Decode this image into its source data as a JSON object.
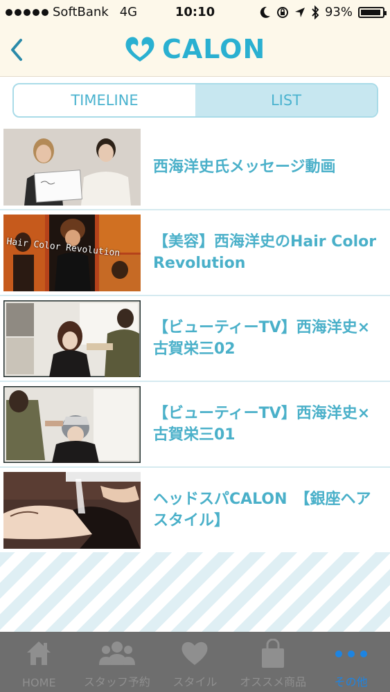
{
  "status_bar": {
    "carrier": "SoftBank",
    "network": "4G",
    "time": "10:10",
    "battery": "93%",
    "battery_level": 0.93
  },
  "header": {
    "logo_text": "CALON",
    "back_icon": "chevron-left-icon"
  },
  "segment": {
    "tabs": [
      {
        "label": "TIMELINE",
        "active": false
      },
      {
        "label": "LIST",
        "active": true
      }
    ]
  },
  "videos": [
    {
      "title": "西海洋史氏メッセージ動画"
    },
    {
      "title": "【美容】西海洋史のHair Color Revolution",
      "thumb_caption": "Hair Color Revolution"
    },
    {
      "title": "【ビューティーTV】西海洋史×古賀栄三02"
    },
    {
      "title": "【ビューティーTV】西海洋史×古賀栄三01"
    },
    {
      "title": "ヘッドスパCALON　【銀座ヘアスタイル】"
    }
  ],
  "tabbar": {
    "items": [
      {
        "label": "HOME",
        "icon": "home-icon"
      },
      {
        "label": "スタッフ予約",
        "icon": "staff-icon"
      },
      {
        "label": "スタイル",
        "icon": "heart-icon"
      },
      {
        "label": "オススメ商品",
        "icon": "shopping-bag-icon"
      },
      {
        "label": "その他",
        "icon": "more-dots-icon",
        "active": true
      }
    ]
  },
  "colors": {
    "accent": "#2ab0d1",
    "title_text": "#4ab0c9",
    "header_bg": "#fdf8ea",
    "tabbar_bg": "#6e6e6e",
    "tabbar_active": "#1d84e2"
  }
}
